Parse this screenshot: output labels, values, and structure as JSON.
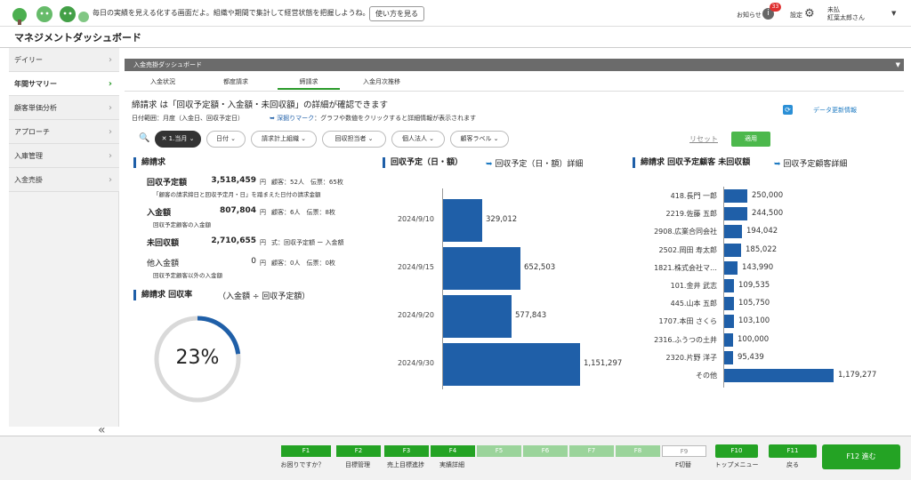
{
  "topbar": {
    "message": "毎日の実績を見える化する画面だよ。組織や期間で集計して経営状態を把握しようね。",
    "howto_button": "使い方を見る",
    "notice_label": "お知らせ",
    "notice_count": "33",
    "settings_label": "設定",
    "user_line1": "未払",
    "user_line2": "紅葉太郎さん"
  },
  "app": {
    "title": "マネジメントダッシュボード"
  },
  "sidebar": {
    "items": [
      {
        "label": "デイリー"
      },
      {
        "label": "年間サマリー"
      },
      {
        "label": "顧客単価分析"
      },
      {
        "label": "アプローチ"
      },
      {
        "label": "入庫管理"
      },
      {
        "label": "入金売掛"
      }
    ]
  },
  "panel": {
    "title": "入金売掛ダッシュボード"
  },
  "tabs": [
    {
      "label": "入金状況"
    },
    {
      "label": "都度請求"
    },
    {
      "label": "締請求"
    },
    {
      "label": "入金月次推移"
    }
  ],
  "main": {
    "description": "締請求 は「回収予定額・入金額・未回収額」の詳細が確認できます",
    "date_range": "日付範囲：月度（入金日、回収予定日）",
    "drill_mark": "深掘りマーク",
    "drill_text": "：グラフや数値をクリックすると詳細情報が表示されます",
    "refresh_label": "データ更新情報"
  },
  "filters": {
    "period": "1.当月",
    "chips": [
      "日付",
      "請求計上組織",
      "回収担当者",
      "個人法人",
      "顧客ラベル"
    ],
    "reset": "リセット",
    "apply": "適用"
  },
  "summary": {
    "title": "締請求",
    "metrics": [
      {
        "label": "回収予定額",
        "value": "3,518,459",
        "unit": "円",
        "extra": "顧客：52人　伝票：65枚",
        "sub": "「顧客の請求締日と回収予定月・日」を踏まえた日付の請求金額"
      },
      {
        "label": "入金額",
        "value": "807,804",
        "unit": "円",
        "extra": "顧客：6人　伝票：8枚",
        "sub": "回収予定顧客の入金額"
      },
      {
        "label": "未回収額",
        "value": "2,710,655",
        "unit": "円",
        "extra": "式：回収予定額 ー 入金額",
        "sub": ""
      },
      {
        "label": "他入金額",
        "value": "0",
        "unit": "円",
        "extra": "顧客：0人　伝票：0枚",
        "sub": "回収予定顧客以外の入金額"
      }
    ]
  },
  "rate": {
    "title": "締請求 回収率",
    "formula": "（入金額 ÷ 回収予定額）",
    "value_text": "23%",
    "value": 0.23
  },
  "schedule": {
    "title": "回収予定（日・額）",
    "link": "回収予定（日・額）詳細"
  },
  "ranking": {
    "title": "締請求 回収予定顧客 未回収額",
    "link": "回収予定顧客詳細"
  },
  "chart_data": [
    {
      "type": "bar",
      "orientation": "horizontal",
      "categories": [
        "2024/9/10",
        "2024/9/15",
        "2024/9/20",
        "2024/9/30"
      ],
      "values": [
        329012,
        652503,
        577843,
        1151297
      ],
      "value_labels": [
        "329,012",
        "652,503",
        "577,843",
        "1,151,297"
      ]
    },
    {
      "type": "bar",
      "orientation": "horizontal",
      "categories": [
        "418.長門 一郎",
        "2219.佐藤 五郎",
        "2908.広業合同会社",
        "2502.岡田 寿太郎",
        "1821.株式会社マ…",
        "101.金井 武志",
        "445.山本 五郎",
        "1707.本田 さくら",
        "2316.ふうつの土井",
        "2320.片野 洋子",
        "その他"
      ],
      "values": [
        250000,
        244500,
        194042,
        185022,
        143990,
        109535,
        105750,
        103100,
        100000,
        95439,
        1179277
      ],
      "value_labels": [
        "250,000",
        "244,500",
        "194,042",
        "185,022",
        "143,990",
        "109,535",
        "105,750",
        "103,100",
        "100,000",
        "95,439",
        "1,179,277"
      ]
    }
  ],
  "footer": {
    "keys": [
      {
        "label": "F1",
        "caption": "お困りですか？",
        "state": "on"
      },
      {
        "label": "F2",
        "caption": "目標管理",
        "state": "on"
      },
      {
        "label": "F3",
        "caption": "売上目標進捗",
        "state": "on"
      },
      {
        "label": "F4",
        "caption": "実績詳細",
        "state": "on"
      },
      {
        "label": "F5",
        "caption": "",
        "state": "off"
      },
      {
        "label": "F6",
        "caption": "",
        "state": "off"
      },
      {
        "label": "F7",
        "caption": "",
        "state": "off"
      },
      {
        "label": "F8",
        "caption": "",
        "state": "off"
      },
      {
        "label": "F9",
        "caption": "F切替",
        "state": "white"
      }
    ],
    "f10": "F10",
    "f10_caption": "トップメニュー",
    "f11": "F11",
    "f11_caption": "戻る",
    "f12": "F12 進む"
  }
}
